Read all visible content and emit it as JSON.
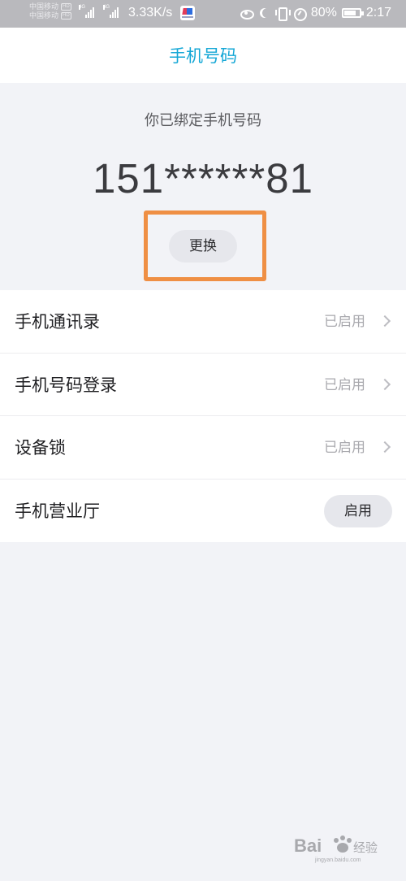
{
  "status_bar": {
    "carrier_1": "中国移动",
    "carrier_2": "中国移动",
    "hd_label": "HD",
    "net_label": "4G",
    "speed": "3.33K/s",
    "battery": "80%",
    "battery_level": 0.8,
    "time": "2:17"
  },
  "header": {
    "title": "手机号码"
  },
  "phone_info": {
    "bound_text": "你已绑定手机号码",
    "number": "151******81",
    "change_label": "更换",
    "highlight_color": "#ef8f44"
  },
  "settings": {
    "items": [
      {
        "label": "手机通讯录",
        "status": "已启用"
      },
      {
        "label": "手机号码登录",
        "status": "已启用"
      },
      {
        "label": "设备锁",
        "status": "已启用"
      },
      {
        "label": "手机营业厅",
        "button": "启用"
      }
    ]
  },
  "watermark": {
    "brand": "Bai",
    "brand_cn": "经验",
    "url": "jingyan.baidu.com"
  },
  "colors": {
    "accent": "#14a7d6",
    "background": "#f2f3f7",
    "button_bg": "#e6e7ec"
  }
}
